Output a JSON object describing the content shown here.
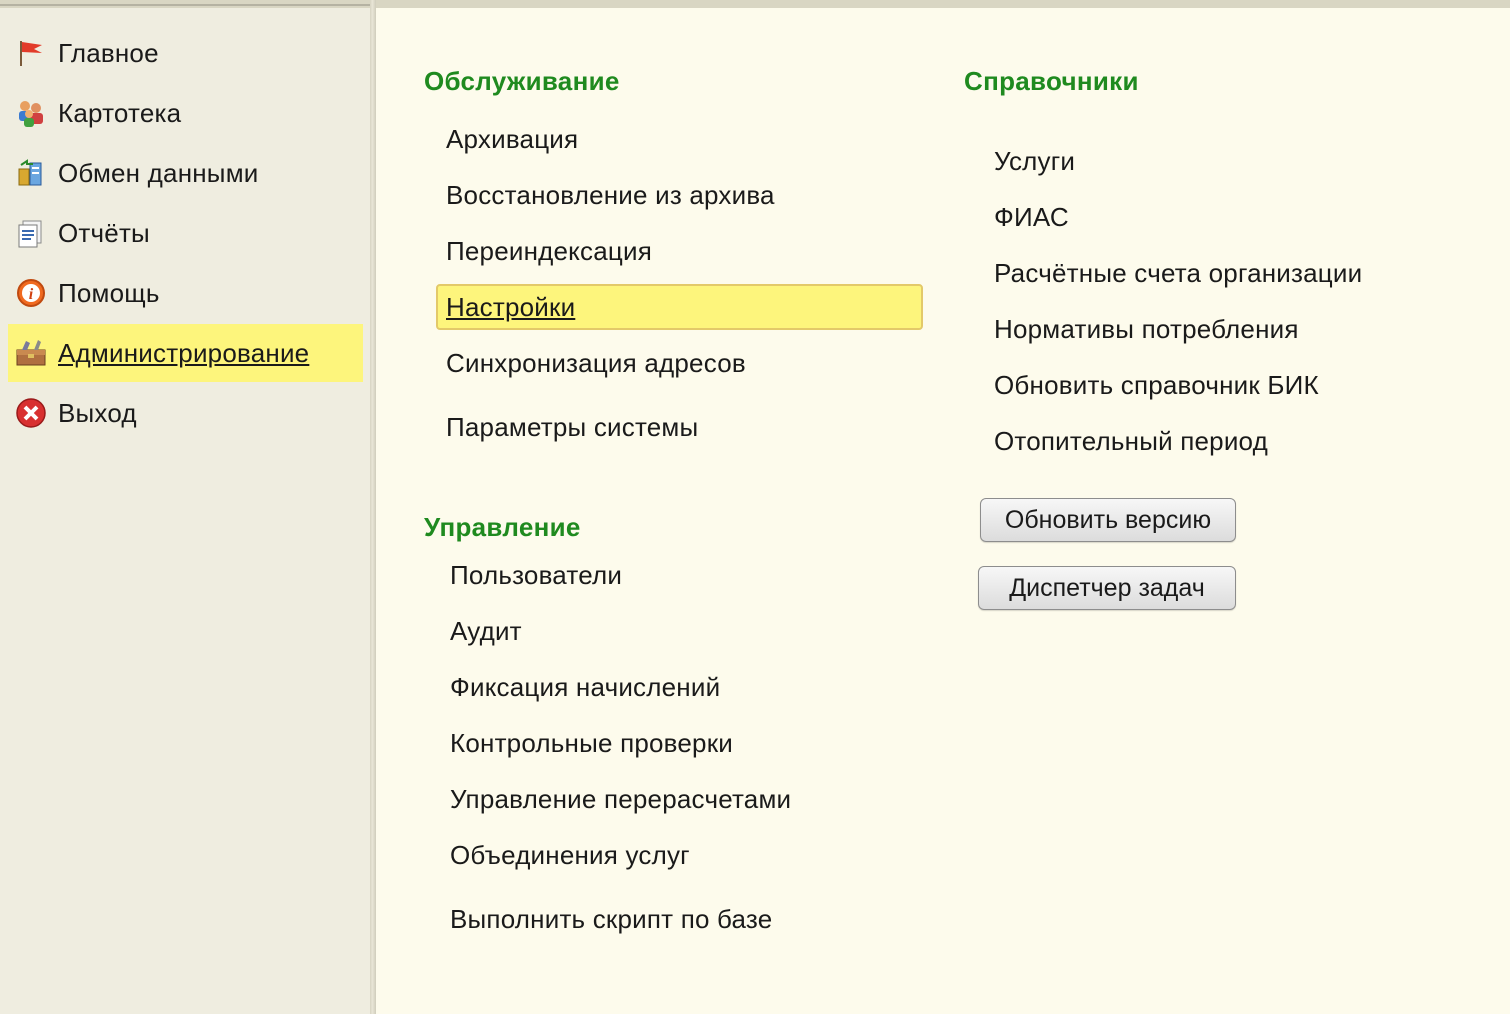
{
  "sidebar": {
    "items": [
      {
        "label": "Главное",
        "icon": "flag-icon"
      },
      {
        "label": "Картотека",
        "icon": "people-icon"
      },
      {
        "label": "Обмен данными",
        "icon": "data-exchange-icon"
      },
      {
        "label": "Отчёты",
        "icon": "reports-icon"
      },
      {
        "label": "Помощь",
        "icon": "help-icon"
      },
      {
        "label": "Администрирование",
        "icon": "admin-toolbox-icon",
        "active": true
      },
      {
        "label": "Выход",
        "icon": "exit-icon"
      }
    ]
  },
  "maintenance": {
    "title": "Обслуживание",
    "items": [
      "Архивация",
      "Восстановление из архива",
      "Переиндексация",
      "Настройки",
      "Синхронизация адресов",
      "Параметры системы"
    ],
    "selected": "Настройки"
  },
  "management": {
    "title": "Управление",
    "items": [
      "Пользователи",
      "Аудит",
      "Фиксация начислений",
      "Контрольные проверки",
      "Управление перерасчетами",
      "Объединения услуг",
      "Выполнить скрипт по базе"
    ]
  },
  "references": {
    "title": "Справочники",
    "items": [
      "Услуги",
      "ФИАС",
      "Расчётные счета организации",
      "Нормативы потребления",
      "Обновить справочник БИК",
      "Отопительный период"
    ]
  },
  "buttons": {
    "update_version": "Обновить версию",
    "task_manager": "Диспетчер задач"
  },
  "colors": {
    "section_title": "#1f8a1f",
    "highlight": "#fdf57c",
    "background": "#fdfbec",
    "sidebar_bg": "#efede0"
  }
}
